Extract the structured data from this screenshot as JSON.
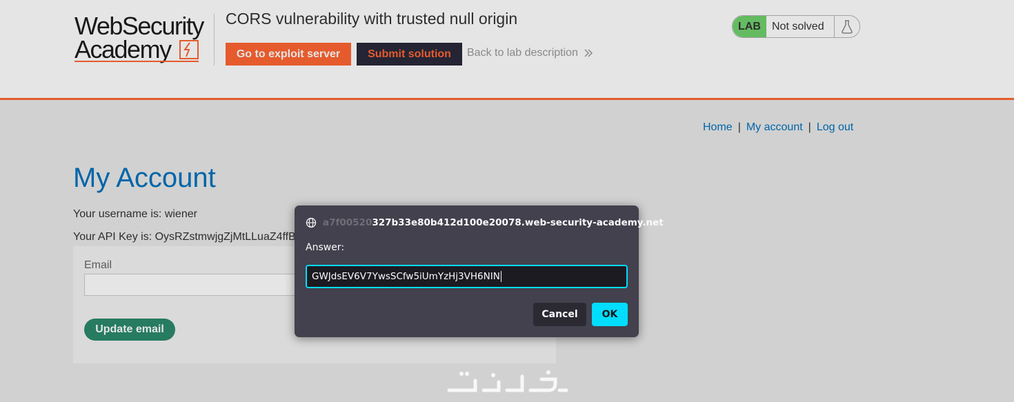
{
  "header": {
    "logo": {
      "line1": "WebSecurity",
      "line2": "Academy"
    },
    "lab_title": "CORS vulnerability with trusted null origin",
    "exploit_button": "Go to exploit server",
    "submit_button": "Submit solution",
    "back_link": "Back to lab description",
    "lab_badge": {
      "tag": "LAB",
      "status": "Not solved"
    }
  },
  "nav": {
    "home": "Home",
    "separator": "|",
    "my_account": "My account",
    "logout": "Log out"
  },
  "page": {
    "title": "My Account",
    "username_line": "Your username is: wiener",
    "api_key_line": "Your API Key is: OysRZstmwjgZjMtLLuaZ4ffB",
    "email_label": "Email",
    "email_value": "",
    "update_button": "Update email"
  },
  "dialog": {
    "origin_prefix": "a7f00520",
    "origin_rest": "327b33e80b412d100e20078.web-security-academy.net",
    "label": "Answer:",
    "input_value": "GWJdsEV6V7YwsSCfw5iUmYzHj3VH6NIN",
    "cancel": "Cancel",
    "ok": "OK"
  },
  "colors": {
    "accent_orange": "#ff6633",
    "link_blue": "#0071bc",
    "lab_green": "#70d16d",
    "dialog_bg": "#42414d",
    "dialog_focus": "#00ddff"
  },
  "icons": [
    "flask-icon",
    "chevron-double-right-icon",
    "globe-icon",
    "academy-logo-mark"
  ]
}
